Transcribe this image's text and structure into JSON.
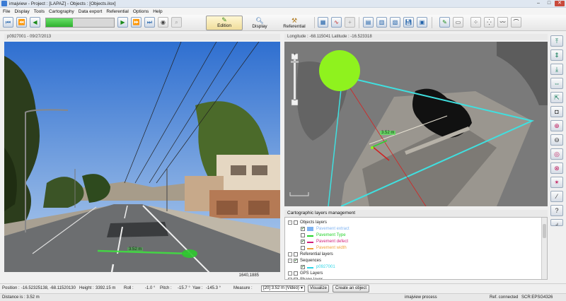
{
  "window": {
    "title": "imajview - Project : [LAPAZ] - Objects : [Objects.ilox]"
  },
  "menu": [
    "File",
    "Display",
    "Tools",
    "Cartography",
    "Data export",
    "Referential",
    "Options",
    "Help"
  ],
  "toolbar": {
    "progress_fraction": 0.4,
    "edition_label": "Edition",
    "display_label": "Display",
    "referential_label": "Referential"
  },
  "street_view": {
    "header": "p0927001 - 09/27/2013",
    "measure_label": "3.52 m",
    "pixel_readout": "1640,1885"
  },
  "aerial_view": {
    "header": "Longitude : -68.115041 Latitude : -16.523318",
    "measure_label": "3.52 m"
  },
  "layers_panel": {
    "title": "Cartographic layers management",
    "items": [
      {
        "label": "Objects layers",
        "level": 0,
        "checked": false,
        "expander": "-"
      },
      {
        "label": "Pavement extract",
        "level": 2,
        "checked": true,
        "color": "#7eb3f2"
      },
      {
        "label": "Pavement Type",
        "level": 2,
        "checked": false,
        "color": "#26d32c"
      },
      {
        "label": "Pavement defect",
        "level": 2,
        "checked": true,
        "color": "#d11f7a"
      },
      {
        "label": "Pavement width",
        "level": 2,
        "checked": false,
        "color": "#f2a23a"
      },
      {
        "label": "Referential layers",
        "level": 0,
        "checked": false,
        "expander": ""
      },
      {
        "label": "Sequences",
        "level": 0,
        "checked": true,
        "expander": "-"
      },
      {
        "label": "p0927001",
        "level": 2,
        "checked": true,
        "color": "#2fd5e6"
      },
      {
        "label": "GPS Layers",
        "level": 0,
        "checked": false,
        "expander": ""
      },
      {
        "label": "Shape layer",
        "level": 0,
        "checked": false,
        "expander": ""
      }
    ]
  },
  "position_bar": {
    "position": "Position :",
    "position_value": "-16.52325138, -68.11520130",
    "height": "Height :",
    "height_value": "3392.15 m",
    "roll": "Roll :",
    "roll_value": "-1.0 °",
    "pitch": "Pitch :",
    "pitch_value": "-15.7 °",
    "yaw": "Yaw :",
    "yaw_value": "-145.3 °",
    "measure": "Measure :",
    "measure_value": "[20] 3.52 m (Video)",
    "visualize": "Visualize",
    "create_object": "Create an object"
  },
  "status_bar": {
    "distance": "Distance is : 3.52 m",
    "process": "imajview process",
    "ref": "Ref. connected",
    "scr": "SCR:EPSG4326"
  },
  "colors": {
    "measure_green": "#3ee53e",
    "footprint_cyan": "#3fe0e0",
    "accent_blue": "#1d5fa8"
  }
}
